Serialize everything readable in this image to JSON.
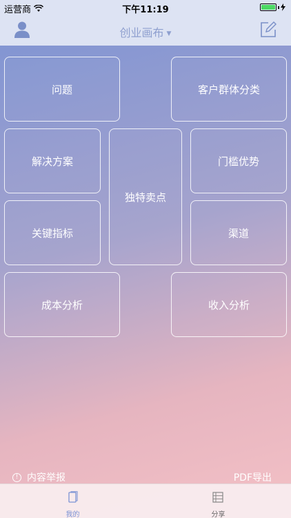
{
  "status_bar": {
    "carrier": "运营商",
    "time": "下午11:19",
    "battery_percent": 100
  },
  "nav": {
    "title": "创业画布",
    "left_icon": "user-icon",
    "right_icon": "edit-icon"
  },
  "canvas": {
    "problem": "问题",
    "customer_segments": "客户群体分类",
    "solution": "解决方案",
    "unique_value": "独特卖点",
    "unfair_advantage": "门槛优势",
    "key_metrics": "关键指标",
    "channels": "渠道",
    "cost_structure": "成本分析",
    "revenue_streams": "收入分析"
  },
  "footer": {
    "report": "内容举报",
    "pdf_export": "PDF导出"
  },
  "tabs": [
    {
      "label": "我的",
      "icon": "document-icon",
      "active": true
    },
    {
      "label": "分享",
      "icon": "list-icon",
      "active": false
    }
  ],
  "colors": {
    "accent": "#7c93d4",
    "bar": "#dde3f3",
    "gradient_top": "#7c93d4",
    "gradient_bottom": "#f4c1c6"
  }
}
